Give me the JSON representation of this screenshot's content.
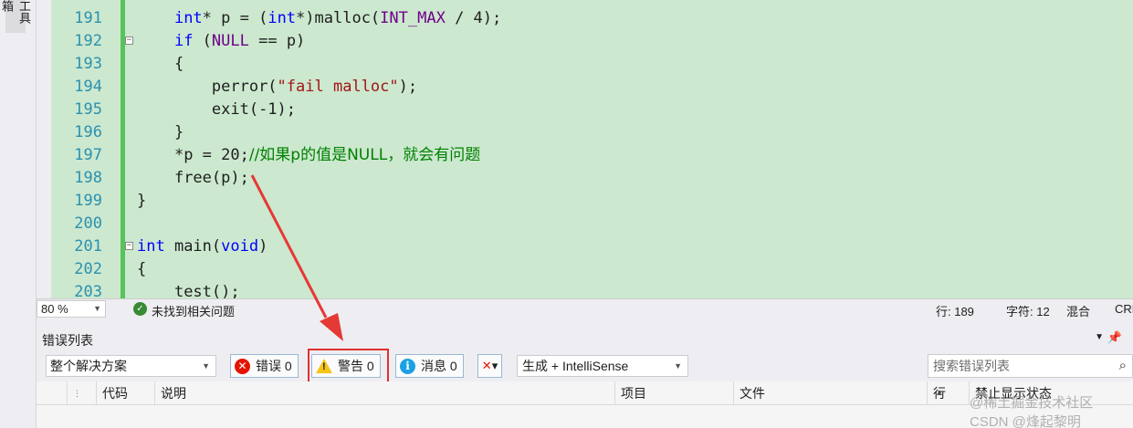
{
  "toolbox": {
    "label": "工具箱"
  },
  "editor": {
    "lines": [
      {
        "num": "191",
        "pre": "    ",
        "segments": [
          {
            "t": "int",
            "c": "kw"
          },
          {
            "t": "* p = (",
            "c": ""
          },
          {
            "t": "int",
            "c": "kw"
          },
          {
            "t": "*)malloc(",
            "c": ""
          },
          {
            "t": "INT_MAX",
            "c": "mc"
          },
          {
            "t": " / 4);",
            "c": ""
          }
        ]
      },
      {
        "num": "192",
        "pre": "    ",
        "segments": [
          {
            "t": "if",
            "c": "kw"
          },
          {
            "t": " (",
            "c": ""
          },
          {
            "t": "NULL",
            "c": "mc"
          },
          {
            "t": " == p)",
            "c": ""
          }
        ]
      },
      {
        "num": "193",
        "pre": "    ",
        "segments": [
          {
            "t": "{",
            "c": ""
          }
        ]
      },
      {
        "num": "194",
        "pre": "        ",
        "segments": [
          {
            "t": "perror(",
            "c": ""
          },
          {
            "t": "\"fail malloc\"",
            "c": "str"
          },
          {
            "t": ");",
            "c": ""
          }
        ]
      },
      {
        "num": "195",
        "pre": "        ",
        "segments": [
          {
            "t": "exit(-1);",
            "c": ""
          }
        ]
      },
      {
        "num": "196",
        "pre": "    ",
        "segments": [
          {
            "t": "}",
            "c": ""
          }
        ]
      },
      {
        "num": "197",
        "pre": "    ",
        "segments": [
          {
            "t": "*p = 20;",
            "c": ""
          },
          {
            "t": "//如果p的值是NULL，就会有问题",
            "c": "cm"
          }
        ]
      },
      {
        "num": "198",
        "pre": "    ",
        "segments": [
          {
            "t": "free(p);",
            "c": ""
          }
        ]
      },
      {
        "num": "199",
        "pre": "",
        "segments": [
          {
            "t": "}",
            "c": ""
          }
        ]
      },
      {
        "num": "200",
        "pre": "",
        "segments": []
      },
      {
        "num": "201",
        "pre": "",
        "segments": [
          {
            "t": "int",
            "c": "kw"
          },
          {
            "t": " main(",
            "c": ""
          },
          {
            "t": "void",
            "c": "kw"
          },
          {
            "t": ")",
            "c": ""
          }
        ]
      },
      {
        "num": "202",
        "pre": "",
        "segments": [
          {
            "t": "{",
            "c": ""
          }
        ]
      },
      {
        "num": "203",
        "pre": "    ",
        "segments": [
          {
            "t": "test();",
            "c": ""
          }
        ]
      }
    ]
  },
  "statusbar": {
    "zoom": "80 %",
    "issues": "未找到相关问题",
    "line": "行: 189",
    "char": "字符: 12",
    "mode": "混合",
    "eol": "CRLF"
  },
  "error_list": {
    "title": "错误列表",
    "scope": "整个解决方案",
    "errors_label": "错误 0",
    "warnings_label": "警告 0",
    "messages_label": "消息 0",
    "source": "生成 + IntelliSense",
    "search_placeholder": "搜索错误列表",
    "columns": [
      "代码",
      "说明",
      "项目",
      "文件",
      "行",
      "禁止显示状态"
    ]
  },
  "watermark": "@稀土掘金技术社区 CSDN @烽起黎明"
}
